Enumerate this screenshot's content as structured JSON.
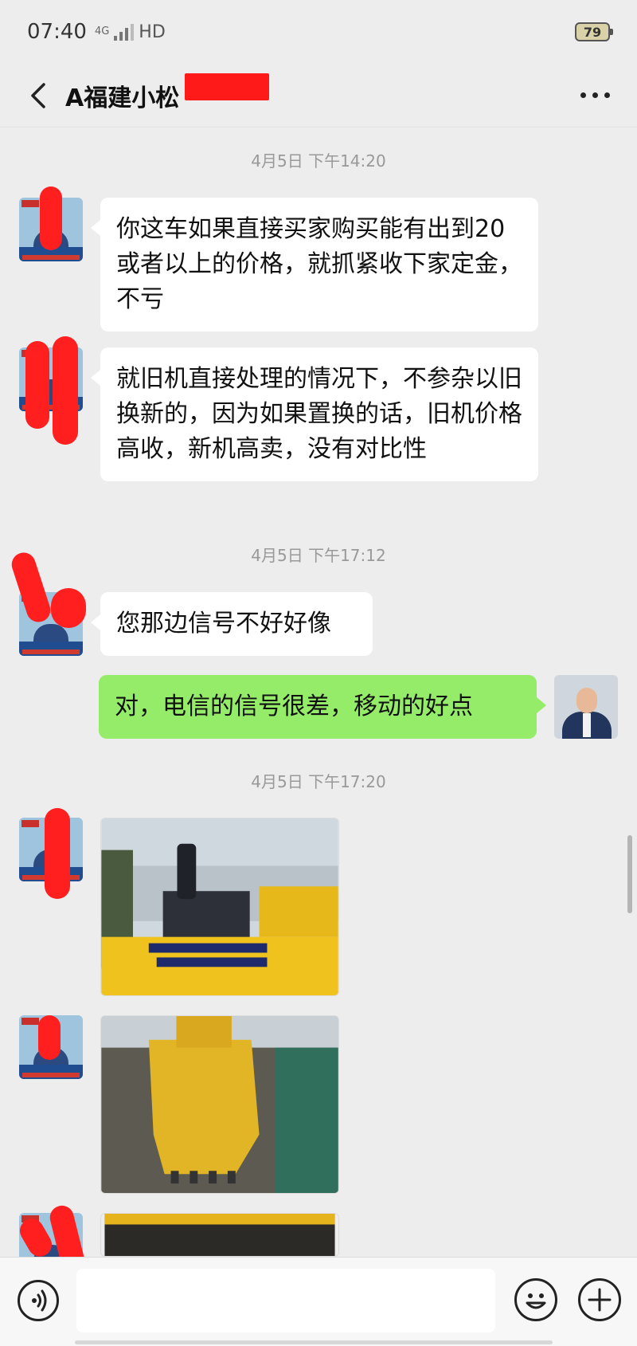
{
  "status": {
    "time": "07:40",
    "network": "4G",
    "hd": "HD",
    "battery": "79"
  },
  "header": {
    "title": "A福建小松"
  },
  "messages": {
    "ts1": "4月5日 下午14:20",
    "m1": "你这车如果直接买家购买能有出到20或者以上的价格，就抓紧收下家定金，不亏",
    "m2": "就旧机直接处理的情况下，不参杂以旧换新的，因为如果置换的话，旧机价格高收，新机高卖，没有对比性",
    "ts2": "4月5日 下午17:12",
    "m3": "您那边信号不好好像",
    "m4": "对，电信的信号很差，移动的好点",
    "ts3": "4月5日 下午17:20"
  },
  "colors": {
    "self_bubble": "#95ec69",
    "other_bubble": "#ffffff",
    "background": "#ededed",
    "redaction": "#ff1f1f"
  },
  "icons": {
    "back": "back-icon",
    "more": "more-icon",
    "voice": "voice-icon",
    "emoji": "emoji-icon",
    "plus": "plus-icon"
  }
}
